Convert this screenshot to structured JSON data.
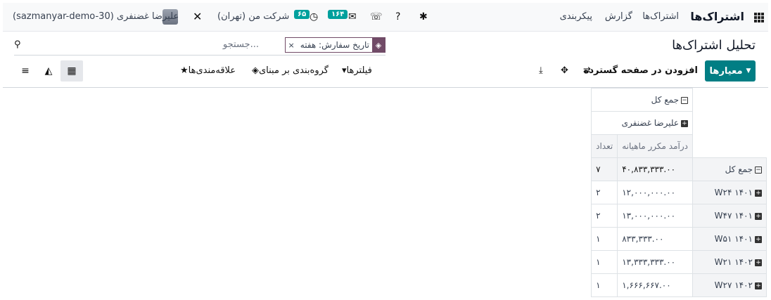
{
  "topbar": {
    "app_name": "اشتراک‌ها",
    "menu": [
      "اشتراک‌ها",
      "گزارش",
      "پیکربندی"
    ],
    "company": "شرکت من (تهران)",
    "activity_count": "۶۵",
    "message_count": "۱۶۴",
    "user_name": "علیرضا غضنفری",
    "db_name": "(sazmanyar-demo-30)"
  },
  "page": {
    "title": "تحلیل اشتراک‌ها"
  },
  "search": {
    "facet_label": "تاریخ سفارش: هفته",
    "facet_remove": "×",
    "placeholder": "جستجو..."
  },
  "toolbar": {
    "measures_label": "معیارها",
    "insert_spreadsheet": "افزودن در صفحه گسترده",
    "filters": "فیلترها",
    "groupby": "گروه‌بندی بر مبنای",
    "favorites": "علاقه‌مندی‌ها"
  },
  "pivot": {
    "col_total": "جمع کل",
    "col_group": "علیرضا غضنفری",
    "measure_mrr": "درآمد مکرر ماهیانه",
    "measure_count": "تعداد",
    "row_total": {
      "label": "جمع کل",
      "mrr": "۴۰,۸۳۳,۳۳۳.۰۰",
      "count": "۷"
    },
    "rows": [
      {
        "label": "W۲۴ ۱۴۰۱",
        "mrr": "۱۲,۰۰۰,۰۰۰.۰۰",
        "count": "۲"
      },
      {
        "label": "W۴۷ ۱۴۰۱",
        "mrr": "۱۳,۰۰۰,۰۰۰.۰۰",
        "count": "۲"
      },
      {
        "label": "W۵۱ ۱۴۰۱",
        "mrr": "۸۳۳,۳۳۳.۰۰",
        "count": "۱"
      },
      {
        "label": "W۲۱ ۱۴۰۲",
        "mrr": "۱۳,۳۳۳,۳۳۳.۰۰",
        "count": "۱"
      },
      {
        "label": "W۲۷ ۱۴۰۲",
        "mrr": "۱,۶۶۶,۶۶۷.۰۰",
        "count": "۱"
      }
    ]
  },
  "colors": {
    "brand": "#714b67",
    "accent": "#017e84",
    "badge": "#00a09d"
  }
}
